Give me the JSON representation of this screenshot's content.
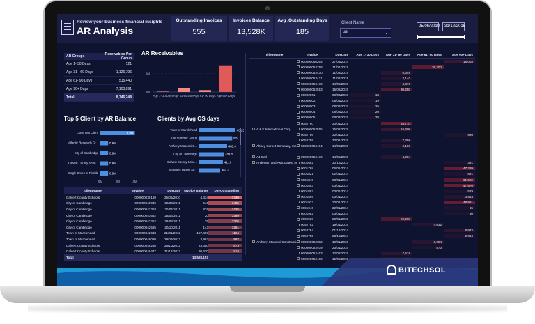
{
  "header": {
    "subtitle": "Review your business financial insights",
    "title": "AR Analysis",
    "kpis": [
      {
        "label": "Outstanding Invoices",
        "value": "555"
      },
      {
        "label": "Invoices Balance",
        "value": "13,528K"
      },
      {
        "label": "Avg .Outstanding Days",
        "value": "185"
      }
    ],
    "client_label": "Client Name",
    "client_value": "All",
    "date_from": "25/06/2010",
    "date_to": "31/12/2015"
  },
  "ar_groups": {
    "headers": [
      "AR Groups",
      "Receivables Per Group"
    ],
    "rows": [
      [
        "Age 1- 30 Days",
        "121"
      ],
      [
        "Age 31 - 60 Days",
        "1,126,796"
      ],
      [
        "Age 61- 90 Days",
        "515,440"
      ],
      [
        "Age 90+ Days",
        "7,103,891"
      ]
    ],
    "total": [
      "Total",
      "8,746,248"
    ]
  },
  "sections": {
    "ar_receivables": "AR Receivables",
    "top5": "Top 5 Client by AR Balance",
    "avg_os": "Clients by Avg OS days"
  },
  "chart_data": [
    {
      "type": "bar",
      "title": "AR Receivables",
      "categories": [
        "Age 1- 30 Days",
        "Age 31-60 Days",
        "Age 61- 90 Days",
        "Age 90+ Days"
      ],
      "values": [
        121,
        1126796,
        515440,
        7103891
      ],
      "yticks": [
        "5M",
        "0M"
      ],
      "ylim": [
        0,
        8000000
      ],
      "colors": [
        "#f28b82",
        "#f28b82",
        "#f28b82",
        "#e05a5a"
      ]
    },
    {
      "type": "bar",
      "orientation": "horizontal",
      "title": "Top 5 Client by AR Balance",
      "categories": [
        "Close Out Client",
        "Atlantic Research Gr...",
        "City of Cambridge",
        "Calvert County Scho...",
        "Eagle Creek of Florida"
      ],
      "values": [
        4.0,
        0.9,
        0.9,
        0.9,
        0.9
      ],
      "labels": [
        "4.0M",
        "0.9M",
        "0.9M",
        "0.9M",
        "0.9M"
      ],
      "xticks": [
        "0M",
        "2M",
        "4M"
      ],
      "xlim": [
        0,
        4.2
      ]
    },
    {
      "type": "bar",
      "orientation": "horizontal",
      "title": "Clients by Avg OS days",
      "categories": [
        "Town of Marblehead",
        "The Summer Group",
        "Anthony Masconi C...",
        "City of Cambridge",
        "Calvert County Scho...",
        "Veterans Health Ad..."
      ],
      "values": [
        631.5,
        574.1,
        485.4,
        428.2,
        411.6,
        364.4
      ],
      "labels": [
        "631.5",
        "574.1",
        "485.4",
        "428.2",
        "411.6",
        "364.4"
      ],
      "xlim": [
        0,
        680
      ]
    }
  ],
  "receivables_table": {
    "headers": [
      "clientName",
      "Invoice",
      "DueDate",
      "Age 1- 30 Days",
      "Age 31- 60 Days",
      "Age 61- 90 Days",
      "Age 90+ Days"
    ],
    "rows": [
      [
        "",
        "000000050264",
        "27/03/2014",
        "",
        "",
        "",
        "15,003"
      ],
      [
        "",
        "000000052318",
        "11/01/2015",
        "",
        "",
        "36,200",
        ""
      ],
      [
        "",
        "000000052430",
        "11/02/2015",
        "",
        "6,346",
        "",
        ""
      ],
      [
        "",
        "000000052431",
        "11/02/2015",
        "",
        "2,140",
        "",
        ""
      ],
      [
        "",
        "000000052479",
        "14/02/2015",
        "",
        "4,870",
        "",
        ""
      ],
      [
        "",
        "000000052513",
        "15/02/2015",
        "",
        "30,250",
        "",
        ""
      ],
      [
        "",
        "00000001",
        "08/03/2015",
        "18",
        "",
        "",
        ""
      ],
      [
        "",
        "00000002",
        "08/03/2015",
        "19",
        "",
        "",
        ""
      ],
      [
        "",
        "00000003",
        "08/03/2015",
        "26",
        "",
        "",
        ""
      ],
      [
        "",
        "00000004",
        "08/03/2015",
        "20",
        "",
        "",
        ""
      ],
      [
        "",
        "00000005",
        "08/03/2015",
        "38",
        "",
        "",
        ""
      ],
      [
        "",
        "0052790",
        "30/01/2015",
        "",
        "53,710",
        "",
        ""
      ],
      [
        "A & E International Corp.",
        "000000052515",
        "15/02/2015",
        "",
        "16,608",
        "",
        ""
      ],
      [
        "",
        "0052786",
        "30/01/2015",
        "",
        "",
        "",
        "930"
      ],
      [
        "",
        "0052788",
        "30/01/2015",
        "",
        "7,296",
        "",
        ""
      ],
      [
        "Abbey Carpet Company, Inc.",
        "000000052494",
        "14/02/2015",
        "",
        "2,188",
        "",
        ""
      ],
      [
        "",
        "",
        "",
        "",
        "",
        "",
        ""
      ],
      [
        "AJ Carl",
        "000000052476",
        "14/02/2015",
        "",
        "4,284",
        "",
        ""
      ],
      [
        "Anderson and Associates, Inc.",
        "0001692",
        "30/12/2013",
        "",
        "",
        "",
        "391"
      ],
      [
        "",
        "0001768",
        "06/01/2014",
        "",
        "",
        "",
        "47,289"
      ],
      [
        "",
        "0001821",
        "02/01/2014",
        "",
        "",
        "",
        "891"
      ],
      [
        "",
        "0001849",
        "03/01/2014",
        "",
        "",
        "",
        "31,522"
      ],
      [
        "",
        "0001853",
        "03/01/2014",
        "",
        "",
        "",
        "47,570"
      ],
      [
        "",
        "0001892",
        "03/01/2014",
        "",
        "",
        "",
        "579"
      ],
      [
        "",
        "0001895",
        "03/01/2014",
        "",
        "",
        "",
        "3,514"
      ],
      [
        "",
        "0001923",
        "20/01/2014",
        "",
        "",
        "",
        "48,961"
      ],
      [
        "",
        "0001946",
        "22/01/2014",
        "",
        "",
        "",
        "65"
      ],
      [
        "",
        "0001952",
        "03/01/2014",
        "",
        "",
        "",
        "30"
      ],
      [
        "",
        "0002030",
        "20/01/2015",
        "",
        "26,268",
        "",
        ""
      ],
      [
        "",
        "0052782",
        "19/01/2015",
        "",
        "",
        "4,032",
        ""
      ],
      [
        "",
        "0052784",
        "01/12/2014",
        "",
        "",
        "",
        "8,972"
      ],
      [
        "",
        "0052785",
        "23/12/2014",
        "",
        "",
        "",
        "2,016"
      ],
      [
        "Anthony Masconi Construction",
        "000000052302",
        "10/01/2015",
        "",
        "",
        "6,054",
        ""
      ],
      [
        "",
        "000000052409",
        "23/01/2015",
        "",
        "",
        "870",
        ""
      ],
      [
        "",
        "000000052453",
        "12/02/2015",
        "",
        "7,516",
        "",
        ""
      ],
      [
        "",
        "000000052466",
        "15/02/2015",
        "",
        "2,150",
        "",
        ""
      ]
    ]
  },
  "invoice_table": {
    "headers": [
      "clientName",
      "Invoice",
      "DueDate",
      "Invoice Balance",
      "DayOutstanding"
    ],
    "rows": [
      [
        "Calvert County Schools",
        "000000039169",
        "25/06/2010",
        "4,434",
        "1739"
      ],
      [
        "City of Cambridge",
        "000000040949",
        "02/03/2011",
        "645",
        "1485"
      ],
      [
        "City of Cambridge",
        "000000041318",
        "30/04/2011",
        "876",
        "1425"
      ],
      [
        "City of Cambridge",
        "000000041652",
        "25/06/2011",
        "20",
        "1369"
      ],
      [
        "City of Cambridge",
        "000000042352",
        "29/08/2011",
        "25",
        "1305"
      ],
      [
        "City of Cambridge",
        "000000042585",
        "20/10/2011",
        "143",
        "1251"
      ],
      [
        "Town of Marblehead",
        "000000042633",
        "21/01/2012",
        "157,498",
        "1164"
      ],
      [
        "Town of Marblehead",
        "000000048080",
        "29/09/2012",
        "3,962",
        "897"
      ],
      [
        "Calvert County Schools",
        "000000048266",
        "26/10/2012",
        "23,450",
        "873"
      ],
      [
        "Calvert County Schools",
        "000000048447",
        "21/12/2012",
        "30,330",
        "816"
      ]
    ],
    "total": [
      "Total",
      "",
      "",
      "13,528,157",
      ""
    ]
  },
  "brand": "BITECHSOL",
  "colors": {
    "bg": "#0e1330",
    "header": "#1a1d3f",
    "accent": "#4f8fe0",
    "red": "#e05a5a"
  }
}
